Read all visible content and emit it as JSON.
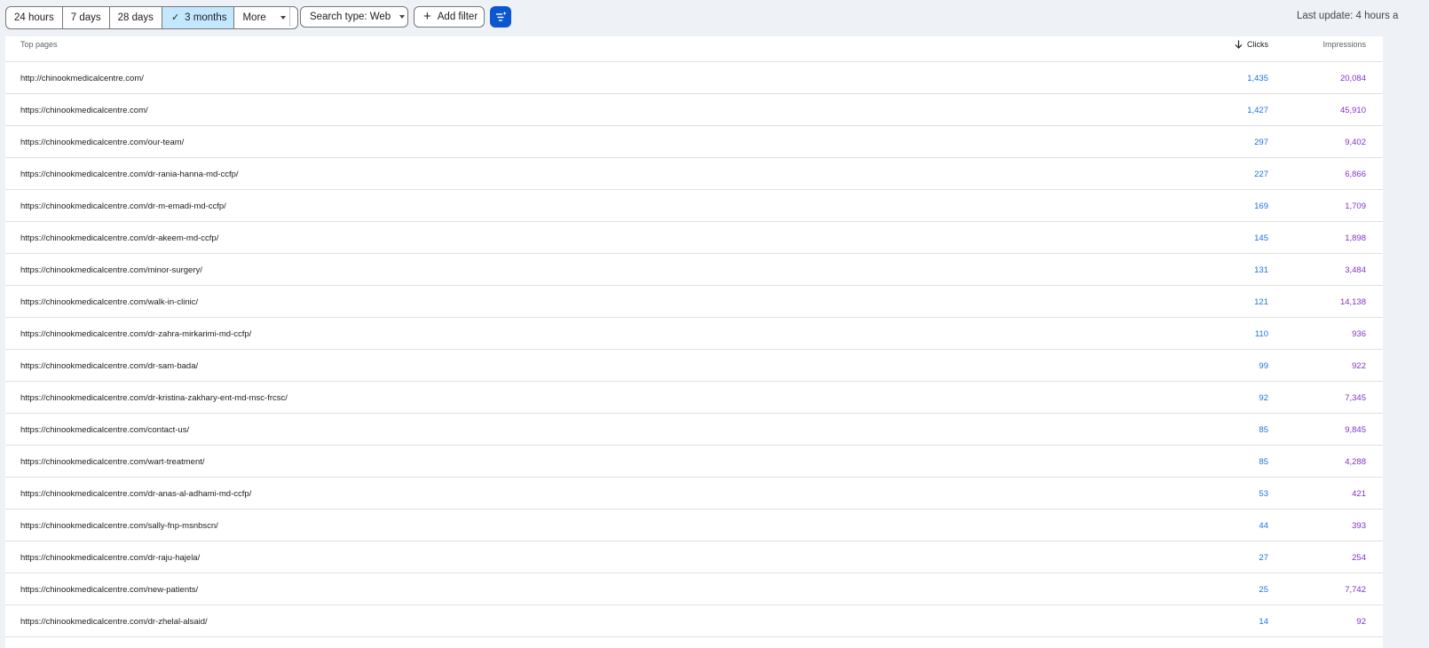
{
  "toolbar": {
    "date_ranges": [
      {
        "label": "24 hours"
      },
      {
        "label": "7 days"
      },
      {
        "label": "28 days"
      },
      {
        "label": "3 months",
        "selected": true
      },
      {
        "label": "More"
      }
    ],
    "search_type_label": "Search type: Web",
    "add_filter_label": "Add filter",
    "last_update": "Last update: 4 hours a"
  },
  "colors": {
    "accent": "#0b57d0",
    "selected_bg": "#c2e7ff",
    "clicks": "#1a73e8",
    "impressions": "#8430ce"
  },
  "table": {
    "headers": {
      "pages": "Top pages",
      "clicks": "Clicks",
      "impressions": "Impressions"
    },
    "sort_icon": "arrow-down-icon",
    "rows": [
      {
        "url": "http://chinookmedicalcentre.com/",
        "clicks": "1,435",
        "impressions": "20,084"
      },
      {
        "url": "https://chinookmedicalcentre.com/",
        "clicks": "1,427",
        "impressions": "45,910"
      },
      {
        "url": "https://chinookmedicalcentre.com/our-team/",
        "clicks": "297",
        "impressions": "9,402"
      },
      {
        "url": "https://chinookmedicalcentre.com/dr-rania-hanna-md-ccfp/",
        "clicks": "227",
        "impressions": "6,866"
      },
      {
        "url": "https://chinookmedicalcentre.com/dr-m-emadi-md-ccfp/",
        "clicks": "169",
        "impressions": "1,709"
      },
      {
        "url": "https://chinookmedicalcentre.com/dr-akeem-md-ccfp/",
        "clicks": "145",
        "impressions": "1,898"
      },
      {
        "url": "https://chinookmedicalcentre.com/minor-surgery/",
        "clicks": "131",
        "impressions": "3,484"
      },
      {
        "url": "https://chinookmedicalcentre.com/walk-in-clinic/",
        "clicks": "121",
        "impressions": "14,138"
      },
      {
        "url": "https://chinookmedicalcentre.com/dr-zahra-mirkarimi-md-ccfp/",
        "clicks": "110",
        "impressions": "936"
      },
      {
        "url": "https://chinookmedicalcentre.com/dr-sam-bada/",
        "clicks": "99",
        "impressions": "922"
      },
      {
        "url": "https://chinookmedicalcentre.com/dr-kristina-zakhary-ent-md-msc-frcsc/",
        "clicks": "92",
        "impressions": "7,345"
      },
      {
        "url": "https://chinookmedicalcentre.com/contact-us/",
        "clicks": "85",
        "impressions": "9,845"
      },
      {
        "url": "https://chinookmedicalcentre.com/wart-treatment/",
        "clicks": "85",
        "impressions": "4,288"
      },
      {
        "url": "https://chinookmedicalcentre.com/dr-anas-al-adhami-md-ccfp/",
        "clicks": "53",
        "impressions": "421"
      },
      {
        "url": "https://chinookmedicalcentre.com/sally-fnp-msnbscn/",
        "clicks": "44",
        "impressions": "393"
      },
      {
        "url": "https://chinookmedicalcentre.com/dr-raju-hajela/",
        "clicks": "27",
        "impressions": "254"
      },
      {
        "url": "https://chinookmedicalcentre.com/new-patients/",
        "clicks": "25",
        "impressions": "7,742"
      },
      {
        "url": "https://chinookmedicalcentre.com/dr-zhelal-alsaid/",
        "clicks": "14",
        "impressions": "92"
      }
    ]
  }
}
